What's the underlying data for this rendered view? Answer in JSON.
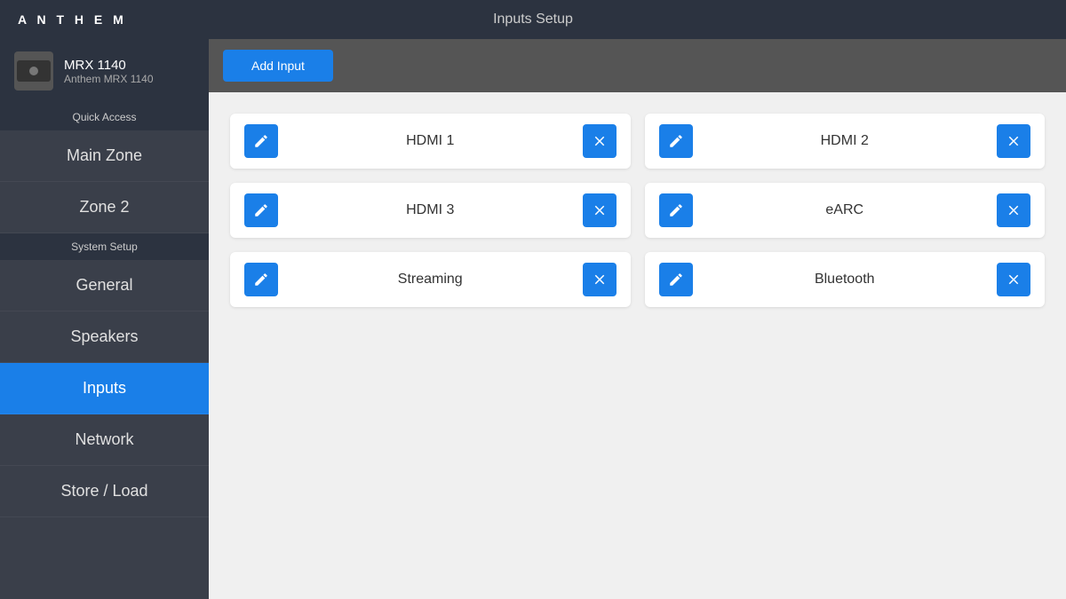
{
  "header": {
    "title": "Inputs Setup",
    "logo": "ANTHEM"
  },
  "device": {
    "name": "MRX 1140",
    "subtitle": "Anthem MRX 1140"
  },
  "sidebar": {
    "quick_access_label": "Quick Access",
    "system_setup_label": "System Setup",
    "items": [
      {
        "id": "main-zone",
        "label": "Main Zone",
        "active": false
      },
      {
        "id": "zone-2",
        "label": "Zone 2",
        "active": false
      },
      {
        "id": "general",
        "label": "General",
        "active": false
      },
      {
        "id": "speakers",
        "label": "Speakers",
        "active": false
      },
      {
        "id": "inputs",
        "label": "Inputs",
        "active": true
      },
      {
        "id": "network",
        "label": "Network",
        "active": false
      },
      {
        "id": "store-load",
        "label": "Store / Load",
        "active": false
      }
    ]
  },
  "content": {
    "add_input_label": "Add Input",
    "inputs": [
      {
        "id": "hdmi1",
        "label": "HDMI 1"
      },
      {
        "id": "hdmi2",
        "label": "HDMI 2"
      },
      {
        "id": "hdmi3",
        "label": "HDMI 3"
      },
      {
        "id": "earc",
        "label": "eARC"
      },
      {
        "id": "streaming",
        "label": "Streaming"
      },
      {
        "id": "bluetooth",
        "label": "Bluetooth"
      }
    ]
  }
}
